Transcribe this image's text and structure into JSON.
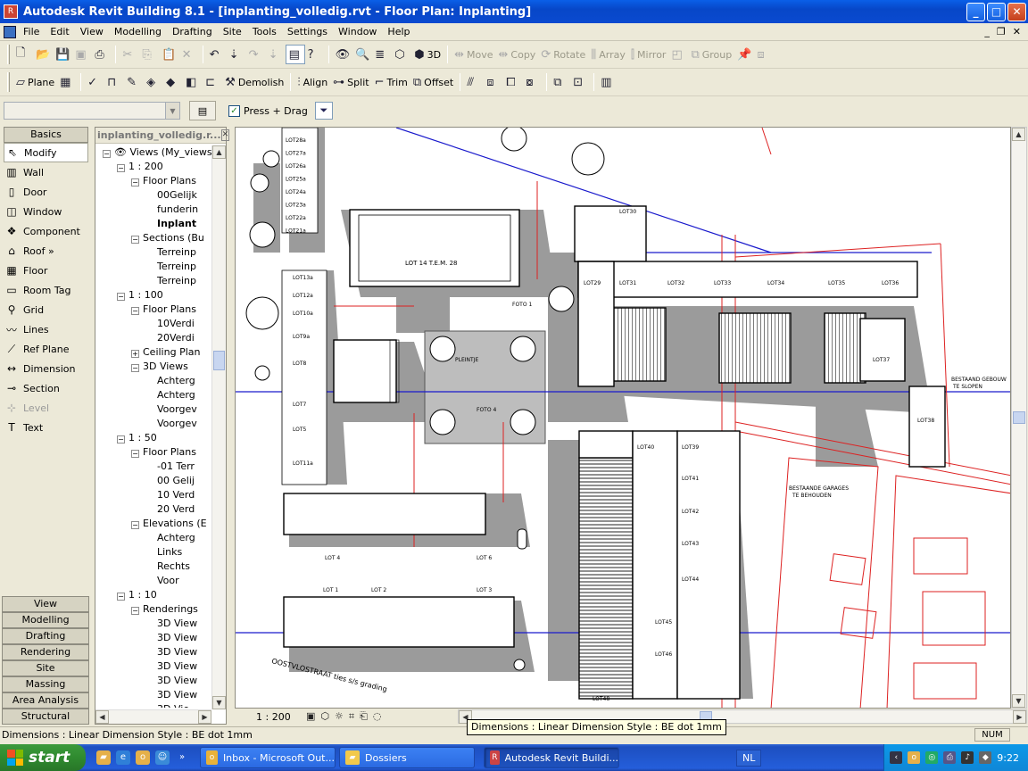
{
  "window": {
    "title": "Autodesk Revit Building 8.1 - [inplanting_volledig.rvt - Floor Plan: Inplanting]",
    "controls": {
      "minimize": "_",
      "maximize": "□",
      "close": "✕"
    }
  },
  "menu": [
    "File",
    "Edit",
    "View",
    "Modelling",
    "Drafting",
    "Site",
    "Tools",
    "Settings",
    "Window",
    "Help"
  ],
  "toolbar_top_text": {
    "view3d": "3D",
    "move": "Move",
    "copy": "Copy",
    "rotate": "Rotate",
    "array": "Array",
    "mirror": "Mirror",
    "group": "Group"
  },
  "toolbar_edit": {
    "plane": "Plane",
    "demolish": "Demolish",
    "align": "Align",
    "split": "Split",
    "trim": "Trim",
    "offset": "Offset"
  },
  "options": {
    "press_drag": "Press + Drag",
    "press_drag_checked": true
  },
  "design_bar": {
    "header": "Basics",
    "tools": [
      {
        "label": "Modify",
        "icon": "modify-icon",
        "glyph": "⇖"
      },
      {
        "label": "Wall",
        "icon": "wall-icon",
        "glyph": "▥"
      },
      {
        "label": "Door",
        "icon": "door-icon",
        "glyph": "▯"
      },
      {
        "label": "Window",
        "icon": "window-icon",
        "glyph": "◫"
      },
      {
        "label": "Component",
        "icon": "component-icon",
        "glyph": "❖"
      },
      {
        "label": "Roof »",
        "icon": "roof-icon",
        "glyph": "⌂"
      },
      {
        "label": "Floor",
        "icon": "floor-icon",
        "glyph": "▦"
      },
      {
        "label": "Room Tag",
        "icon": "room-tag-icon",
        "glyph": "▭"
      },
      {
        "label": "Grid",
        "icon": "grid-icon",
        "glyph": "⚲"
      },
      {
        "label": "Lines",
        "icon": "lines-icon",
        "glyph": "〰"
      },
      {
        "label": "Ref Plane",
        "icon": "ref-plane-icon",
        "glyph": "⟋"
      },
      {
        "label": "Dimension",
        "icon": "dimension-icon",
        "glyph": "↔"
      },
      {
        "label": "Section",
        "icon": "section-icon",
        "glyph": "⊸"
      },
      {
        "label": "Level",
        "icon": "level-icon",
        "glyph": "⊹"
      },
      {
        "label": "Text",
        "icon": "text-icon",
        "glyph": "T"
      }
    ],
    "tabs": [
      "View",
      "Modelling",
      "Drafting",
      "Rendering",
      "Site",
      "Massing",
      "Area Analysis",
      "Structural"
    ]
  },
  "browser": {
    "title": "inplanting_volledig.r...",
    "rows": [
      {
        "d": 0,
        "pm": "−",
        "text": "Views (My_views"
      },
      {
        "d": 1,
        "pm": "−",
        "text": "1 : 200"
      },
      {
        "d": 2,
        "pm": "−",
        "text": "Floor Plans"
      },
      {
        "d": 3,
        "pm": "",
        "text": "00Gelijk"
      },
      {
        "d": 3,
        "pm": "",
        "text": "funderin"
      },
      {
        "d": 3,
        "pm": "",
        "text": "Inplant",
        "bold": true
      },
      {
        "d": 2,
        "pm": "−",
        "text": "Sections (Bu"
      },
      {
        "d": 3,
        "pm": "",
        "text": "Terreinp"
      },
      {
        "d": 3,
        "pm": "",
        "text": "Terreinp"
      },
      {
        "d": 3,
        "pm": "",
        "text": "Terreinp"
      },
      {
        "d": 1,
        "pm": "−",
        "text": "1 : 100"
      },
      {
        "d": 2,
        "pm": "−",
        "text": "Floor Plans"
      },
      {
        "d": 3,
        "pm": "",
        "text": "10Verdi"
      },
      {
        "d": 3,
        "pm": "",
        "text": "20Verdi"
      },
      {
        "d": 2,
        "pm": "+",
        "text": "Ceiling Plan"
      },
      {
        "d": 2,
        "pm": "−",
        "text": "3D Views"
      },
      {
        "d": 3,
        "pm": "",
        "text": "Achterg"
      },
      {
        "d": 3,
        "pm": "",
        "text": "Achterg"
      },
      {
        "d": 3,
        "pm": "",
        "text": "Voorgev"
      },
      {
        "d": 3,
        "pm": "",
        "text": "Voorgev"
      },
      {
        "d": 1,
        "pm": "−",
        "text": "1 : 50"
      },
      {
        "d": 2,
        "pm": "−",
        "text": "Floor Plans"
      },
      {
        "d": 3,
        "pm": "",
        "text": "-01 Terr"
      },
      {
        "d": 3,
        "pm": "",
        "text": "00 Gelij"
      },
      {
        "d": 3,
        "pm": "",
        "text": "10 Verd"
      },
      {
        "d": 3,
        "pm": "",
        "text": "20 Verd"
      },
      {
        "d": 2,
        "pm": "−",
        "text": "Elevations (E"
      },
      {
        "d": 3,
        "pm": "",
        "text": "Achterg"
      },
      {
        "d": 3,
        "pm": "",
        "text": "Links"
      },
      {
        "d": 3,
        "pm": "",
        "text": "Rechts"
      },
      {
        "d": 3,
        "pm": "",
        "text": "Voor"
      },
      {
        "d": 1,
        "pm": "−",
        "text": "1 : 10"
      },
      {
        "d": 2,
        "pm": "−",
        "text": "Renderings"
      },
      {
        "d": 3,
        "pm": "",
        "text": "3D View"
      },
      {
        "d": 3,
        "pm": "",
        "text": "3D View"
      },
      {
        "d": 3,
        "pm": "",
        "text": "3D View"
      },
      {
        "d": 3,
        "pm": "",
        "text": "3D View"
      },
      {
        "d": 3,
        "pm": "",
        "text": "3D View"
      },
      {
        "d": 3,
        "pm": "",
        "text": "3D View"
      },
      {
        "d": 3,
        "pm": "",
        "text": "3D Vie"
      }
    ]
  },
  "drawing": {
    "lots_top_left": [
      "LOT28a",
      "LOT27a",
      "LOT26a",
      "LOT25a",
      "LOT24a",
      "LOT23a",
      "LOT22a",
      "LOT21a"
    ],
    "lots_left": [
      "LOT13a",
      "LOT12a",
      "LOT10a",
      "LOT9a",
      "LOT8",
      "LOT7",
      "LOT5",
      "LOT11a"
    ],
    "lots_row_top": [
      "LOT29",
      "LOT31",
      "LOT32",
      "LOT33",
      "LOT34",
      "LOT35",
      "LOT36"
    ],
    "lots_right_col": [
      "LOT40",
      "LOT39",
      "LOT41",
      "LOT42",
      "LOT43",
      "LOT44",
      "LOT45",
      "LOT46",
      "LOT48"
    ],
    "lots_bottom": [
      "LOT 4",
      "LOT 6",
      "LOT 1",
      "LOT 2",
      "LOT 3"
    ],
    "misc_labels": {
      "lot14": "LOT 14 T.E.M. 28",
      "lot37": "LOT37",
      "lot38": "LOT38",
      "lot30": "LOT30",
      "pleintje": "PLEINTJE",
      "foto1": "FOTO 1",
      "foto4": "FOTO 4",
      "existing_building": "BESTAAND GEBOUW",
      "to_demolish": "TE SLOPEN",
      "existing_garages": "BESTAANDE GARAGES",
      "to_keep": "TE BEHOUDEN",
      "street": "OOSTVLOSTRAAT  ties s/s grading"
    }
  },
  "view_bar": {
    "scale": "1 : 200"
  },
  "status": {
    "text": "Dimensions : Linear Dimension Style : BE dot 1mm",
    "num": "NUM"
  },
  "tooltip": "Dimensions : Linear Dimension Style : BE dot 1mm",
  "taskbar": {
    "start": "start",
    "tasks": [
      {
        "label": "Inbox - Microsoft Out...",
        "icon": "outlook-icon",
        "color": "#e8b23a"
      },
      {
        "label": "Dossiers",
        "icon": "folder-icon",
        "color": "#f2c94c"
      },
      {
        "label": "Autodesk Revit Buildi...",
        "icon": "revit-icon",
        "color": "#c44",
        "active": true
      }
    ],
    "lang": "NL",
    "clock": "9:22"
  }
}
